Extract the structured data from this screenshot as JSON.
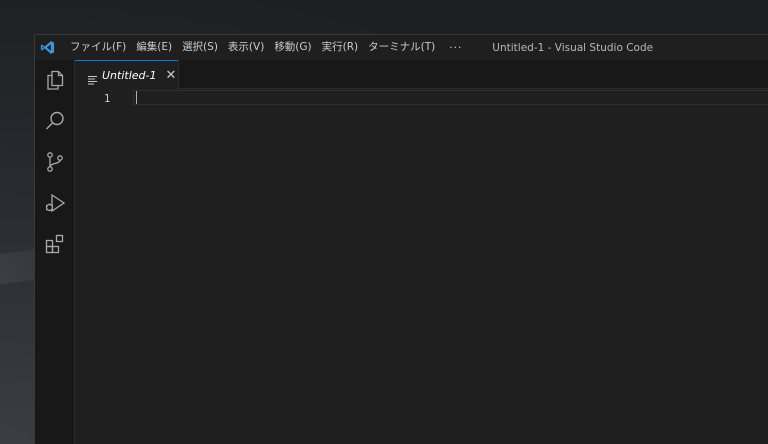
{
  "window": {
    "title": "Untitled-1 - Visual Studio Code"
  },
  "menu": {
    "items": [
      {
        "label": "ファイル(F)"
      },
      {
        "label": "編集(E)"
      },
      {
        "label": "選択(S)"
      },
      {
        "label": "表示(V)"
      },
      {
        "label": "移動(G)"
      },
      {
        "label": "実行(R)"
      },
      {
        "label": "ターミナル(T)"
      }
    ],
    "more_label": "···"
  },
  "activitybar": {
    "items": [
      {
        "icon": "explorer-icon"
      },
      {
        "icon": "search-icon"
      },
      {
        "icon": "source-control-icon"
      },
      {
        "icon": "run-debug-icon"
      },
      {
        "icon": "extensions-icon"
      }
    ]
  },
  "tabs": [
    {
      "label": "Untitled-1",
      "close": "✕",
      "icon": "file-lines-icon",
      "active": true
    }
  ],
  "editor": {
    "line_numbers": [
      "1"
    ]
  },
  "colors": {
    "accent": "#0078d4",
    "logo": "#3a96dd",
    "background": "#1f1f1f",
    "sidebar": "#181818"
  }
}
